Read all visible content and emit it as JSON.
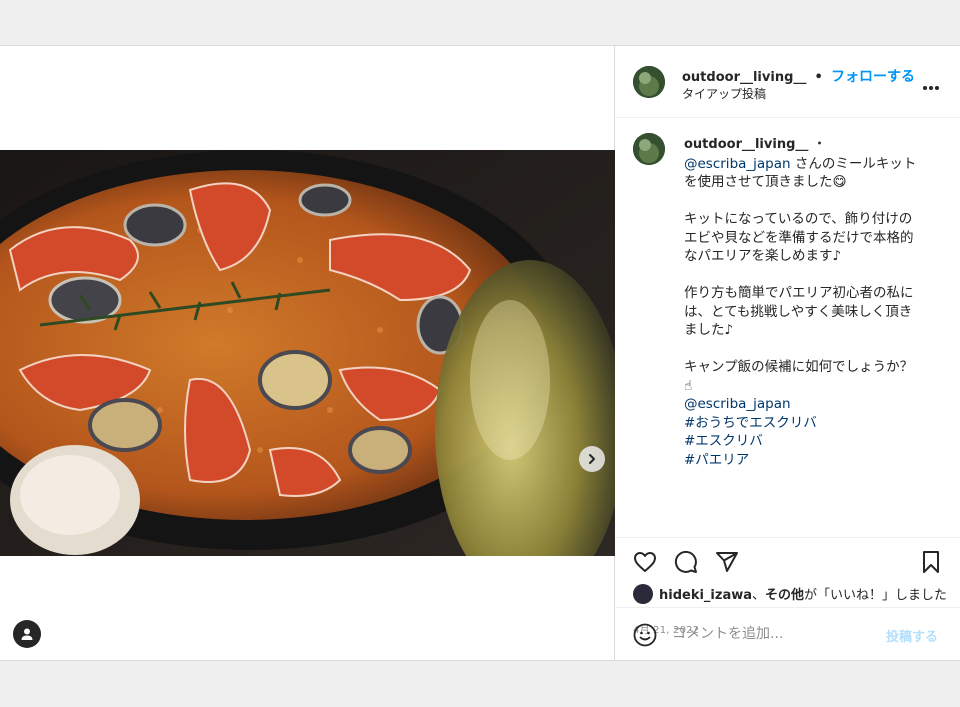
{
  "header": {
    "username": "outdoor__living__",
    "separator": "•",
    "follow_label": "フォローする",
    "subtitle": "タイアップ投稿",
    "more_icon": "more-horizontal-icon"
  },
  "caption": {
    "username": "outdoor__living__",
    "separator": "・",
    "mention": "@escriba_japan",
    "line1_rest": " さんのミールキット",
    "line2": "を使用させて頂きました",
    "line2_emoji": "😋",
    "para2": [
      "キットになっているので、飾り付けの",
      "エビや貝などを準備するだけで本格的",
      "なパエリアを楽しめます♪"
    ],
    "para3": [
      "作り方も簡単でパエリア初心者の私に",
      "は、とても挑戦しやすく美味しく頂き",
      "ました♪"
    ],
    "para4": "キャンプ飯の候補に如何でしょうか？",
    "point_emoji": "☝",
    "mention2": "@escriba_japan",
    "hashtags": [
      "#おうちでエスクリバ",
      "#エスクリバ",
      "#パエリア"
    ]
  },
  "actions": {
    "like_icon": "heart-icon",
    "comment_icon": "comment-icon",
    "share_icon": "share-icon",
    "save_icon": "bookmark-icon"
  },
  "likes": {
    "user": "hideki_izawa",
    "sep": "、",
    "others": "その他",
    "text": "が「いいね！」しました"
  },
  "date": "4月 21, 2022",
  "comment": {
    "placeholder": "コメントを追加...",
    "post_label": "投稿する",
    "emoji_icon": "smiley-icon"
  },
  "media": {
    "description_icon": "user-tag-icon",
    "next_icon": "chevron-right-icon"
  }
}
